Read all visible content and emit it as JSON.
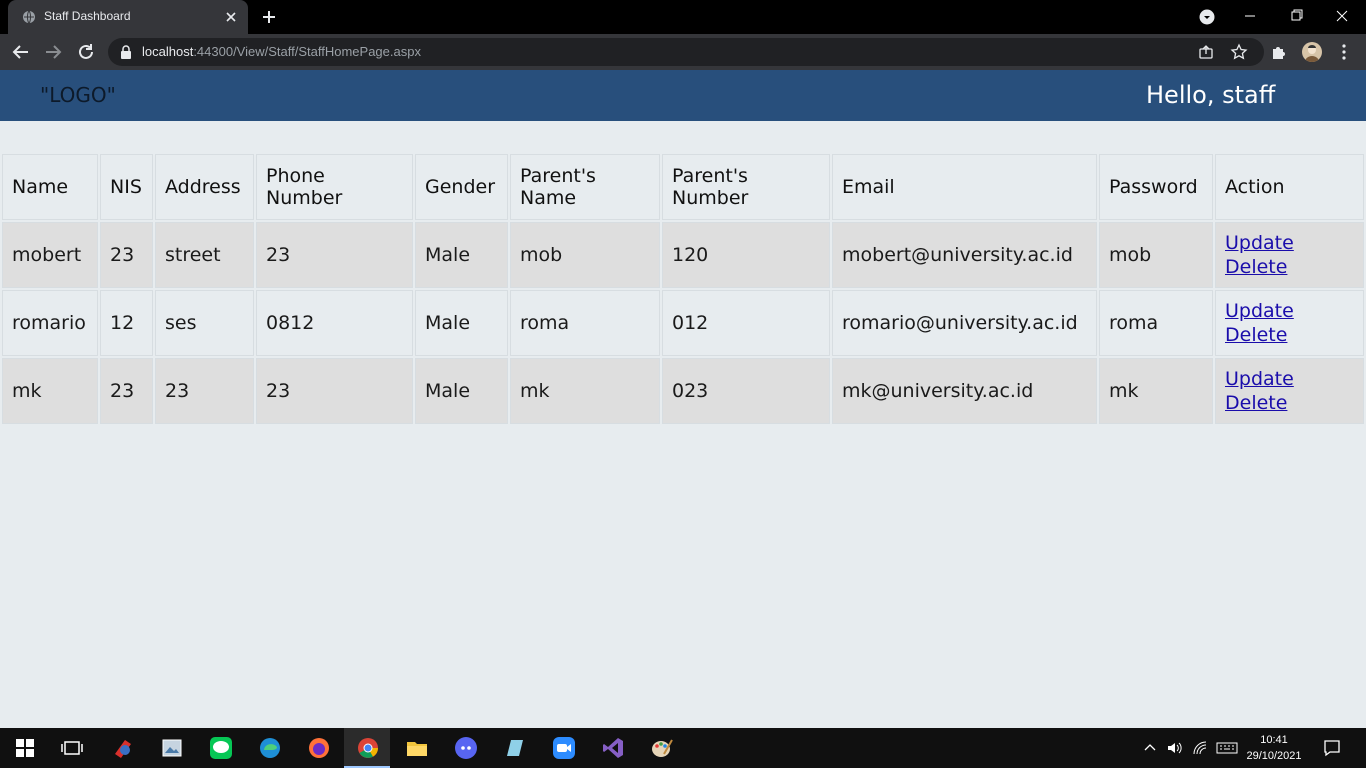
{
  "browser": {
    "tab_title": "Staff Dashboard",
    "url_host": "localhost",
    "url_path": ":44300/View/Staff/StaffHomePage.aspx"
  },
  "header": {
    "logo": "\"LOGO\"",
    "greeting": "Hello, staff",
    "bg_color": "#284f7c"
  },
  "table": {
    "columns": [
      "Name",
      "NIS",
      "Address",
      "Phone Number",
      "Gender",
      "Parent's Name",
      "Parent's Number",
      "Email",
      "Password",
      "Action"
    ],
    "rows": [
      {
        "name": "mobert",
        "nis": "23",
        "address": "street",
        "phone": "23",
        "gender": "Male",
        "parent_name": "mob",
        "parent_number": "120",
        "email": "mobert@university.ac.id",
        "password": "mob",
        "update": "Update",
        "delete": "Delete"
      },
      {
        "name": "romario",
        "nis": "12",
        "address": "ses",
        "phone": "0812",
        "gender": "Male",
        "parent_name": "roma",
        "parent_number": "012",
        "email": "romario@university.ac.id",
        "password": "roma",
        "update": "Update",
        "delete": "Delete"
      },
      {
        "name": "mk",
        "nis": "23",
        "address": "23",
        "phone": "23",
        "gender": "Male",
        "parent_name": "mk",
        "parent_number": "023",
        "email": "mk@university.ac.id",
        "password": "mk",
        "update": "Update",
        "delete": "Delete"
      }
    ]
  },
  "taskbar": {
    "time": "10:41",
    "date": "29/10/2021",
    "apps": [
      "start-icon",
      "task-view-icon",
      "ccleaner-icon",
      "image-viewer-icon",
      "line-icon",
      "edge-icon",
      "firefox-icon",
      "chrome-icon",
      "file-explorer-icon",
      "discord-icon",
      "notes-icon",
      "zoom-icon",
      "visual-studio-icon",
      "paint-icon"
    ]
  }
}
